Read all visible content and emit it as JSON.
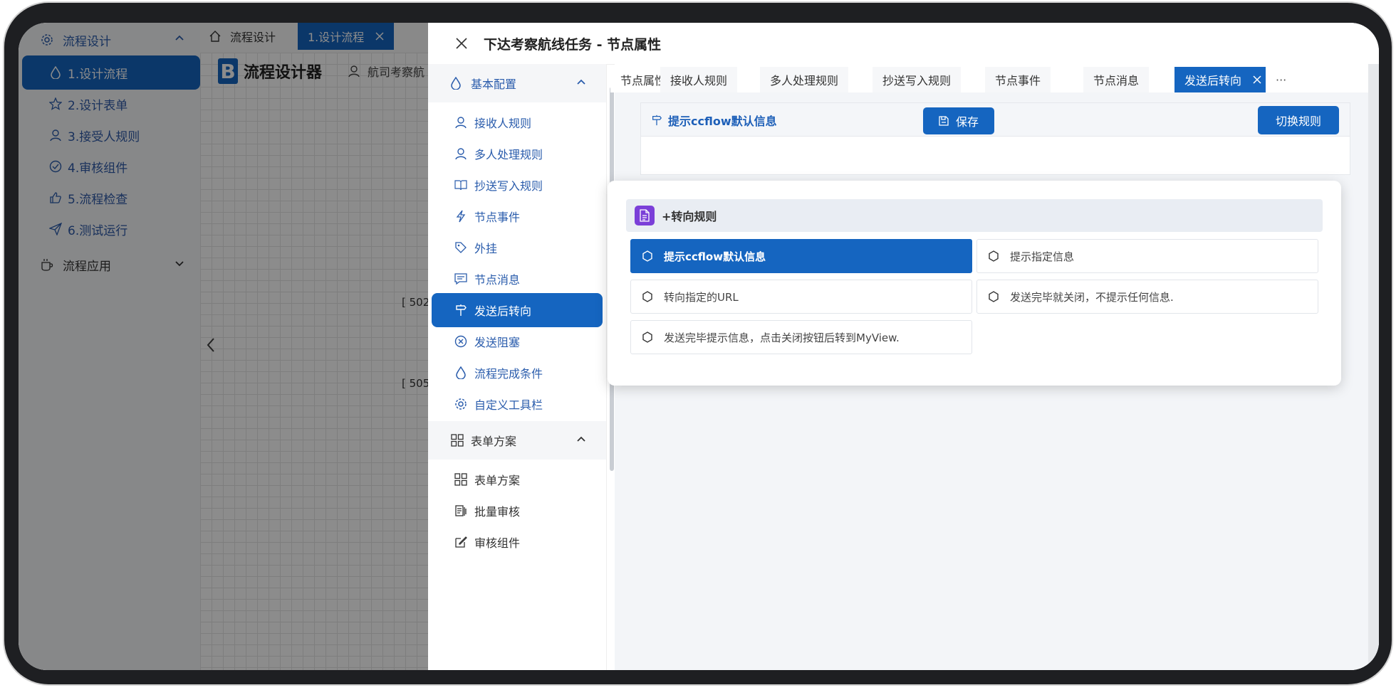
{
  "sidebar": {
    "group1": "流程设计",
    "items": [
      {
        "label": "1.设计流程"
      },
      {
        "label": "2.设计表单"
      },
      {
        "label": "3.接受人规则"
      },
      {
        "label": "4.审核组件"
      },
      {
        "label": "5.流程检查"
      },
      {
        "label": "6.测试运行"
      }
    ],
    "group2": "流程应用"
  },
  "topbar": {
    "tab_home": "流程设计",
    "tab_active": "1.设计流程"
  },
  "designer": {
    "logo_letter": "B",
    "logo_text": "流程设计器",
    "user_crumb": "航司考察航",
    "node_a": "[ 502",
    "node_b": "[ 505"
  },
  "drawer": {
    "title": "下达考察航线任务 - 节点属性",
    "nav": {
      "group_basic": "基本配置",
      "basic_items": [
        {
          "label": "接收人规则"
        },
        {
          "label": "多人处理规则"
        },
        {
          "label": "抄送写入规则"
        },
        {
          "label": "节点事件"
        },
        {
          "label": "外挂"
        },
        {
          "label": "节点消息"
        },
        {
          "label": "发送后转向"
        },
        {
          "label": "发送阻塞"
        },
        {
          "label": "流程完成条件"
        },
        {
          "label": "自定义工具栏"
        }
      ],
      "group_form": "表单方案",
      "form_items": [
        {
          "label": "表单方案"
        },
        {
          "label": "批量审核"
        },
        {
          "label": "审核组件"
        }
      ]
    },
    "tabs": [
      {
        "label": "节点属性"
      },
      {
        "label": "接收人规则"
      },
      {
        "label": "多人处理规则"
      },
      {
        "label": "抄送写入规则"
      },
      {
        "label": "节点事件"
      },
      {
        "label": "节点消息"
      },
      {
        "label": "发送后转向"
      }
    ],
    "more": "···",
    "card": {
      "title": "提示ccflow默认信息",
      "save_label": "保存",
      "switch_label": "切换规则"
    },
    "popup": {
      "title": "+转向规则",
      "options": [
        {
          "label": "提示ccflow默认信息"
        },
        {
          "label": "提示指定信息"
        },
        {
          "label": "转向指定的URL"
        },
        {
          "label": "发送完毕就关闭，不提示任何信息."
        },
        {
          "label": "发送完毕提示信息，点击关闭按钮后转到MyView."
        }
      ]
    }
  },
  "colors": {
    "accent": "#1565c0",
    "doc_icon": "#7b3fd8"
  }
}
